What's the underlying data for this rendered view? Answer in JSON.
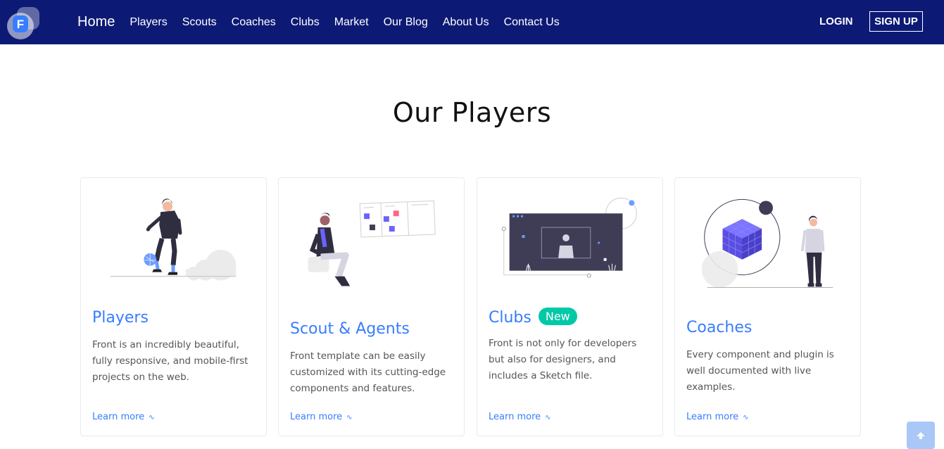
{
  "nav": {
    "logo_letter": "F",
    "links": [
      "Home",
      "Players",
      "Scouts",
      "Coaches",
      "Clubs",
      "Market",
      "Our Blog",
      "About Us",
      "Contact Us"
    ],
    "login": "LOGIN",
    "signup": "SIGN UP"
  },
  "section": {
    "title": "Our Players"
  },
  "cards": [
    {
      "title": "Players",
      "text": "Front is an incredibly beautiful, fully responsive, and mobile-first projects on the web.",
      "link": "Learn more",
      "illustration": "soccer-player-illustration"
    },
    {
      "title": "Scout & Agents",
      "text": "Front template can be easily customized with its cutting-edge components and features.",
      "link": "Learn more",
      "illustration": "scout-board-illustration"
    },
    {
      "title": "Clubs",
      "badge": "New",
      "text": "Front is not only for developers but also for designers, and includes a Sketch file.",
      "link": "Learn more",
      "illustration": "video-screen-illustration"
    },
    {
      "title": "Coaches",
      "text": "Every component and plugin is well documented with live examples.",
      "link": "Learn more",
      "illustration": "cube-coach-illustration"
    }
  ],
  "colors": {
    "navbar": "#0d1a75",
    "accent": "#377dff",
    "badge": "#00c9a7",
    "scroll_button": "#a9c8f8"
  },
  "scroll_top_icon": "arrow-up-icon"
}
